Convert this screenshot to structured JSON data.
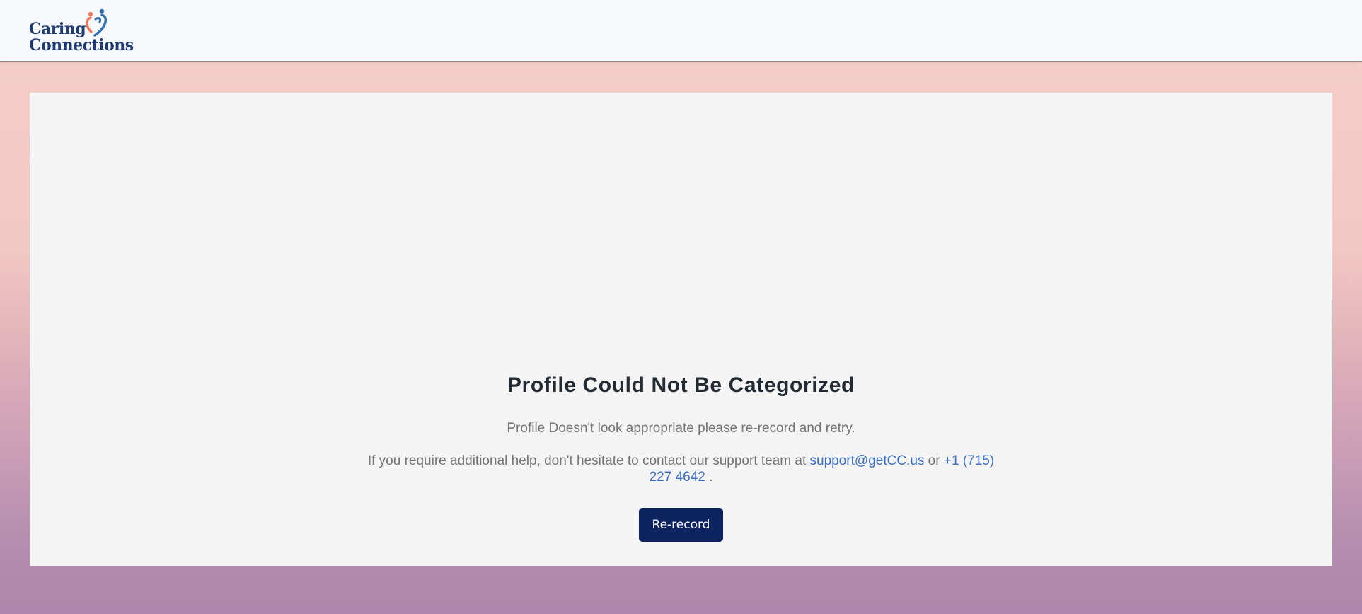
{
  "header": {
    "logo_line1": "Caring",
    "logo_line2": "Connections"
  },
  "main": {
    "title": "Profile Could Not Be Categorized",
    "message": "Profile Doesn't look appropriate please re-record and retry.",
    "help_prefix": "If you require additional help, don't hesitate to contact our support team at ",
    "support_email": "support@getCC.us",
    "help_or": " or ",
    "support_phone": "+1 (715) 227 4642",
    "help_suffix": " .",
    "rerecord_label": "Re-record"
  },
  "colors": {
    "brand_navy": "#0d2461",
    "link_blue": "#3a6fc4",
    "logo_heart_coral": "#ec7860",
    "logo_heart_blue": "#2f6fae"
  }
}
